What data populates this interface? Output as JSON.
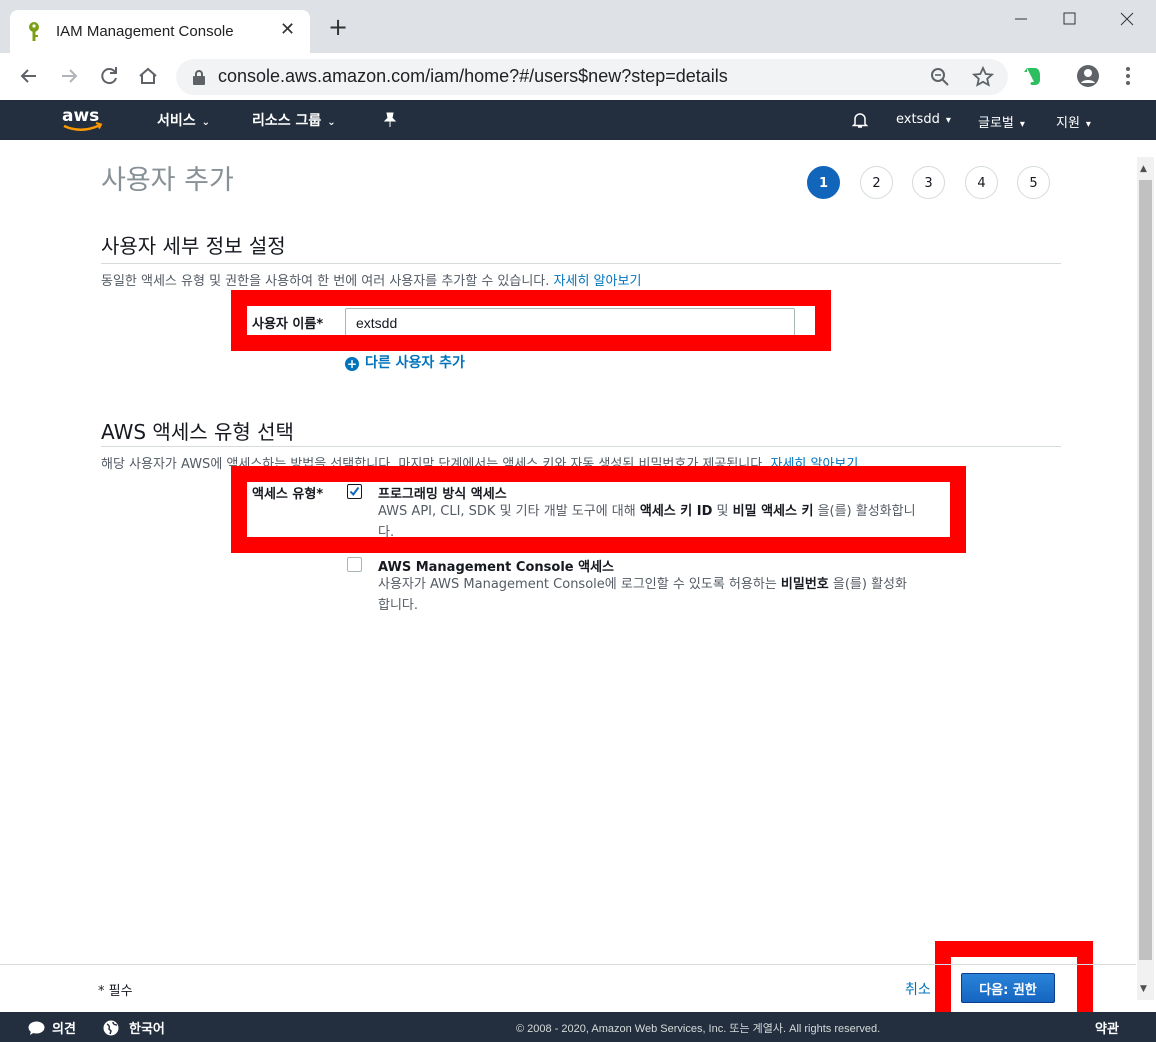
{
  "browser": {
    "tab_title": "IAM Management Console",
    "url": "console.aws.amazon.com/iam/home?#/users$new?step=details"
  },
  "aws_nav": {
    "services": "서비스",
    "resource_groups": "리소스 그룹",
    "account": "extsdd",
    "region": "글로벌",
    "support": "지원"
  },
  "page": {
    "title": "사용자 추가",
    "steps": [
      "1",
      "2",
      "3",
      "4",
      "5"
    ],
    "active_step": 1
  },
  "user_details": {
    "heading": "사용자 세부 정보 설정",
    "description": "동일한 액세스 유형 및 권한을 사용하여 한 번에 여러 사용자를 추가할 수 있습니다.",
    "learn_more": "자세히 알아보기",
    "username_label": "사용자 이름*",
    "username_value": "extsdd",
    "add_another": "다른 사용자 추가"
  },
  "access_type": {
    "heading": "AWS 액세스 유형 선택",
    "description": "해당 사용자가 AWS에 액세스하는 방법을 선택합니다. 마지막 단계에서는 액세스 키와 자동 생성된 비밀번호가 제공됩니다.",
    "learn_more": "자세히 알아보기",
    "label": "액세스 유형*",
    "programmatic": {
      "title": "프로그래밍 방식 액세스",
      "desc_pre": "AWS API, CLI, SDK 및 기타 개발 도구에 대해 ",
      "desc_b1": "액세스 키 ID",
      "desc_mid": " 및 ",
      "desc_b2": "비밀 액세스 키",
      "desc_post": " 을(를) 활성화합니다.",
      "checked": true
    },
    "console": {
      "title": "AWS Management Console 액세스",
      "desc_pre": "사용자가 AWS Management Console에 로그인할 수 있도록 허용하는 ",
      "desc_b": "비밀번호",
      "desc_post": " 을(를) 활성화합니다.",
      "checked": false
    }
  },
  "footer": {
    "required": "* 필수",
    "cancel": "취소",
    "next": "다음: 권한"
  },
  "bottom_bar": {
    "feedback": "의견",
    "language": "한국어",
    "copyright": "© 2008 - 2020, Amazon Web Services, Inc. 또는 계열사. All rights reserved.",
    "terms": "약관"
  },
  "colors": {
    "aws_nav_bg": "#232f3e",
    "link": "#0073bb",
    "highlight": "#ff0000",
    "primary_button": "#1565c0"
  }
}
